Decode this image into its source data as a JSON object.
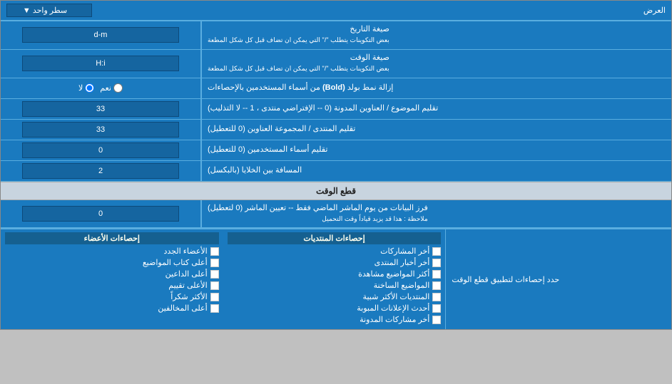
{
  "header": {
    "display_label": "العرض",
    "dropdown_label": "سطر واحد",
    "dropdown_arrow": "▼"
  },
  "rows": [
    {
      "id": "date_format",
      "label": "صيغة التاريخ\nبعض التكوينات يتطلب \"/\" التي يمكن ان تضاف قبل كل شكل المطعة",
      "value": "d-m",
      "type": "input"
    },
    {
      "id": "time_format",
      "label": "صيغة الوقت\nبعض التكوينات يتطلب \"/\" التي يمكن ان تضاف قبل كل شكل المطعة",
      "value": "H:i",
      "type": "input"
    },
    {
      "id": "bold_remove",
      "label": "إزالة نمط بولد (Bold) من أسماء المستخدمين بالإحصاءات",
      "radio_yes": "نعم",
      "radio_no": "لا",
      "selected": "no",
      "type": "radio"
    },
    {
      "id": "topic_count",
      "label": "تقليم الموضوع / العناوين المدونة (0 -- الإفتراضي منتدى , 1 -- لا التذليب)",
      "value": "33",
      "type": "input"
    },
    {
      "id": "forum_count",
      "label": "تقليم المنتدى / المجموعة العناوين (0 للتعطيل)",
      "value": "33",
      "type": "input"
    },
    {
      "id": "user_count",
      "label": "تقليم أسماء المستخدمين (0 للتعطيل)",
      "value": "0",
      "type": "input"
    },
    {
      "id": "cell_spacing",
      "label": "المسافة بين الخلايا (بالبكسل)",
      "value": "2",
      "type": "input"
    }
  ],
  "section_cutoff": {
    "title": "قطع الوقت",
    "row": {
      "label": "فرز البيانات من يوم الماشر الماضي فقط -- تعيين الماشر (0 لتعطيل)\nملاحظة : هذا قد يزيد قياداً وقت التحميل",
      "value": "0"
    },
    "apply_label": "حدد إحصاءات لتطبيق قطع الوقت"
  },
  "stats": {
    "col1_title": "إحصاءات المنتديات",
    "col1_items": [
      "أخر المشاركات",
      "أخر أخبار المنتدى",
      "أكثر المواضيع مشاهدة",
      "المواضيع الساخنة",
      "المنتديات الأكثر شبية",
      "أحدث الإعلانات المبوبة",
      "أخر مشاركات المدونة"
    ],
    "col2_title": "إحصاءات الأعضاء",
    "col2_items": [
      "الأعضاء الجدد",
      "أعلى كتاب المواضيع",
      "أعلى الداعين",
      "الأعلى تقييم",
      "الأكثر شكراً",
      "أعلى المخالفين"
    ]
  }
}
